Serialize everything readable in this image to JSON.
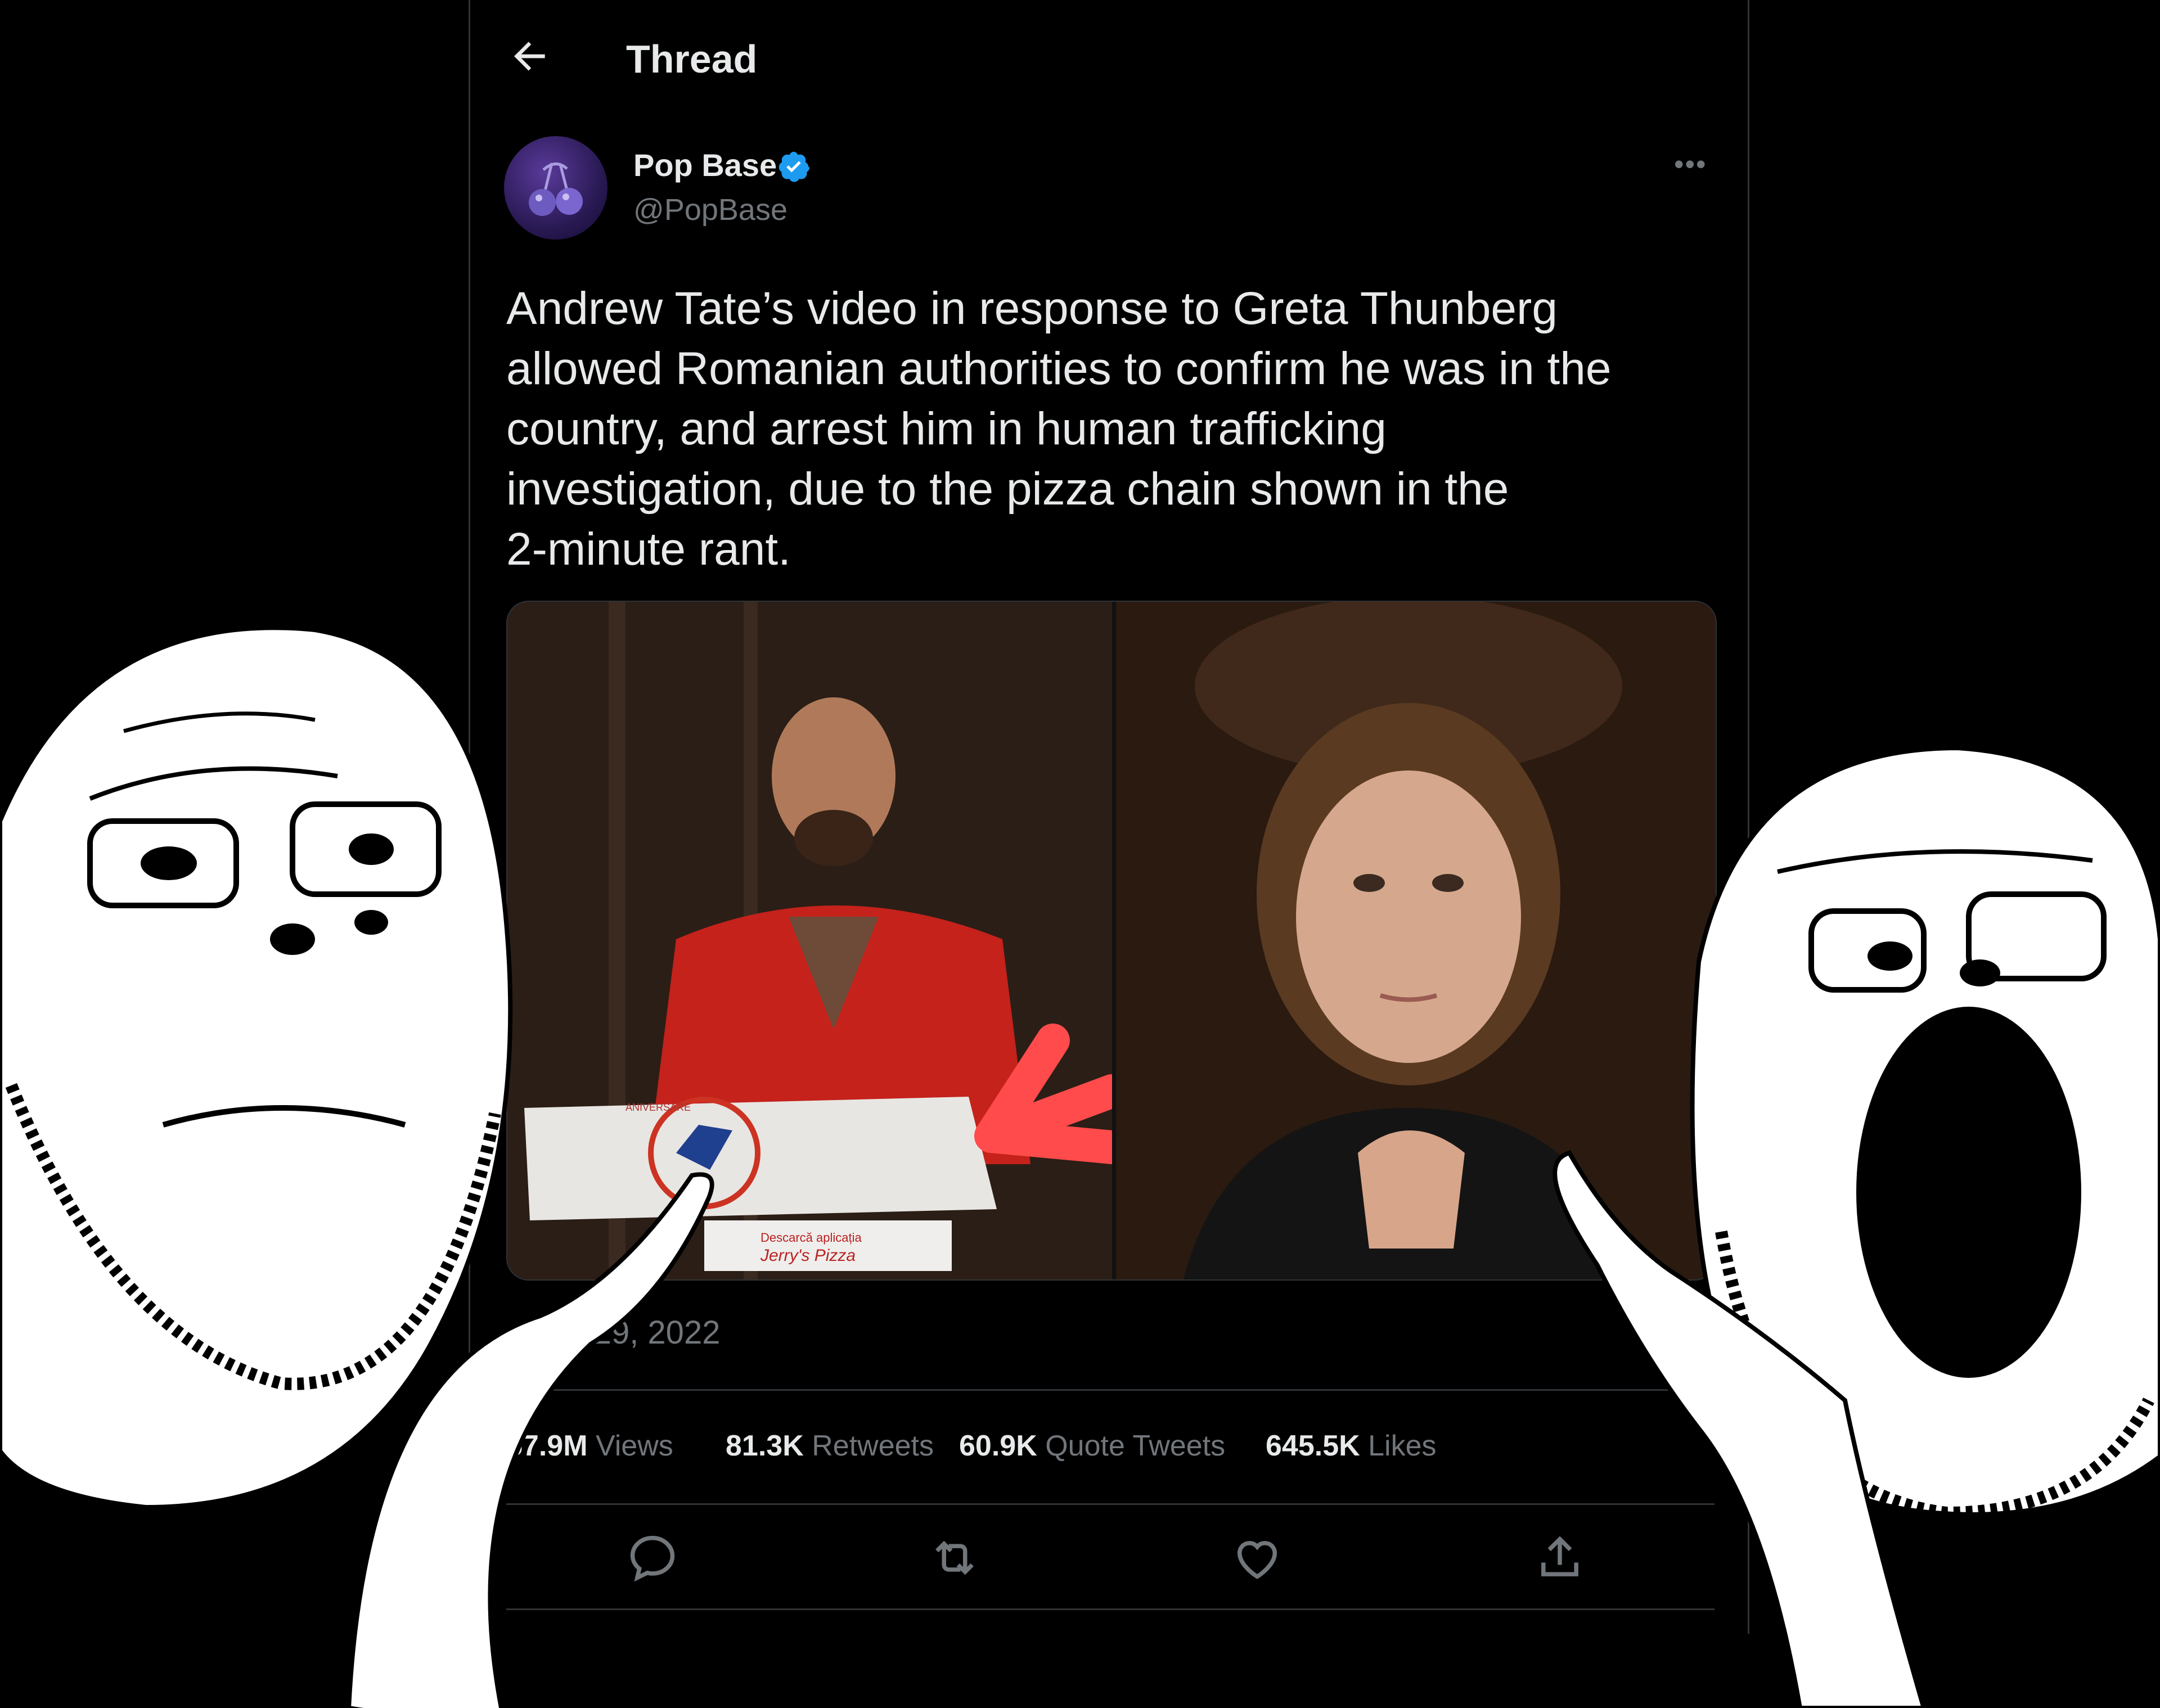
{
  "header": {
    "back_icon": "arrow-left-icon",
    "title": "Thread"
  },
  "author": {
    "name": "Pop Base",
    "handle": "@PopBase",
    "verified": true,
    "avatar_icon": "cherries-logo"
  },
  "tweet": {
    "text": "Andrew Tate’s video in response to Greta Thunberg\nallowed Romanian authorities to confirm he was in the\ncountry, and arrest him in human trafficking\ninvestigation, due to the pizza chain shown in the\n2-minute rant.",
    "timestamp": "· Dec 29, 2022",
    "media": {
      "left_image_text": [
        "ANIVERSARE",
        "Descarcă aplicația",
        "Jerry's Pizza"
      ]
    }
  },
  "stats": [
    {
      "value": "57.9M",
      "label": "Views"
    },
    {
      "value": "81.3K",
      "label": "Retweets"
    },
    {
      "value": "60.9K",
      "label": "Quote Tweets"
    },
    {
      "value": "645.5K",
      "label": "Likes"
    }
  ],
  "actions": [
    "reply-icon",
    "retweet-icon",
    "like-icon",
    "share-icon"
  ],
  "colors": {
    "background": "#000000",
    "text": "#e7e9ea",
    "muted": "#71767b",
    "border": "#2f3336",
    "verified": "#1d9bf0",
    "arrow": "#ff4b4b"
  }
}
